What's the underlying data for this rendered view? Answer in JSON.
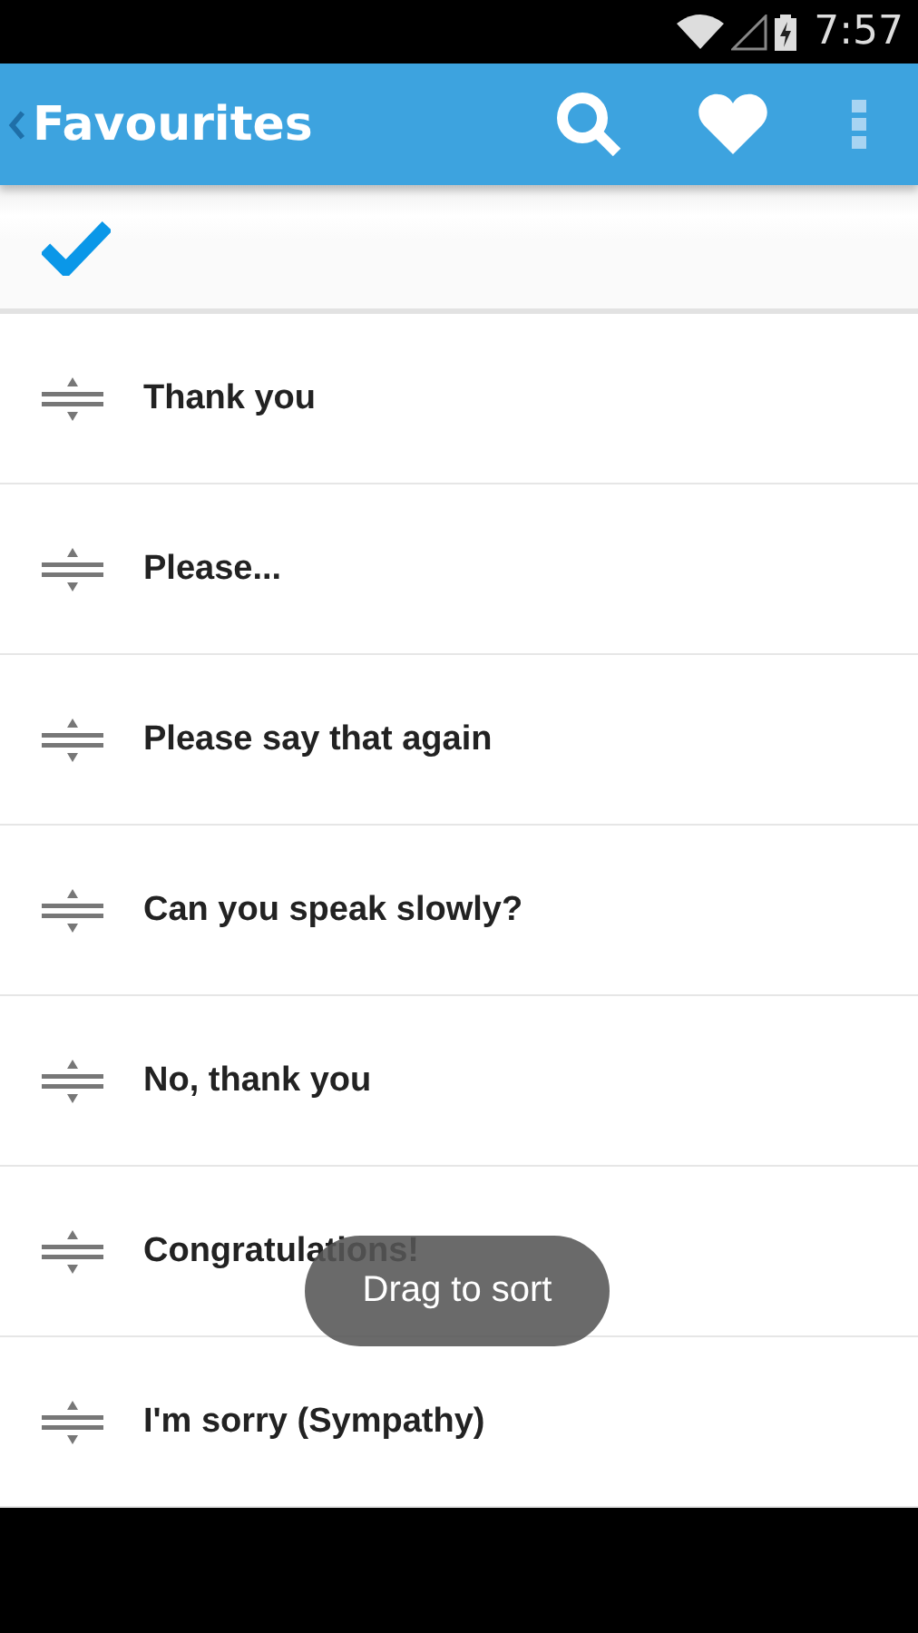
{
  "status_bar": {
    "time": "7:57"
  },
  "app_bar": {
    "title": "Favourites"
  },
  "phrases": [
    {
      "text": "Thank you"
    },
    {
      "text": "Please..."
    },
    {
      "text": "Please say that again"
    },
    {
      "text": "Can you speak slowly?"
    },
    {
      "text": "No, thank you"
    },
    {
      "text": "Congratulations!"
    },
    {
      "text": "I'm sorry (Sympathy)"
    }
  ],
  "toast": {
    "text": "Drag to sort"
  }
}
